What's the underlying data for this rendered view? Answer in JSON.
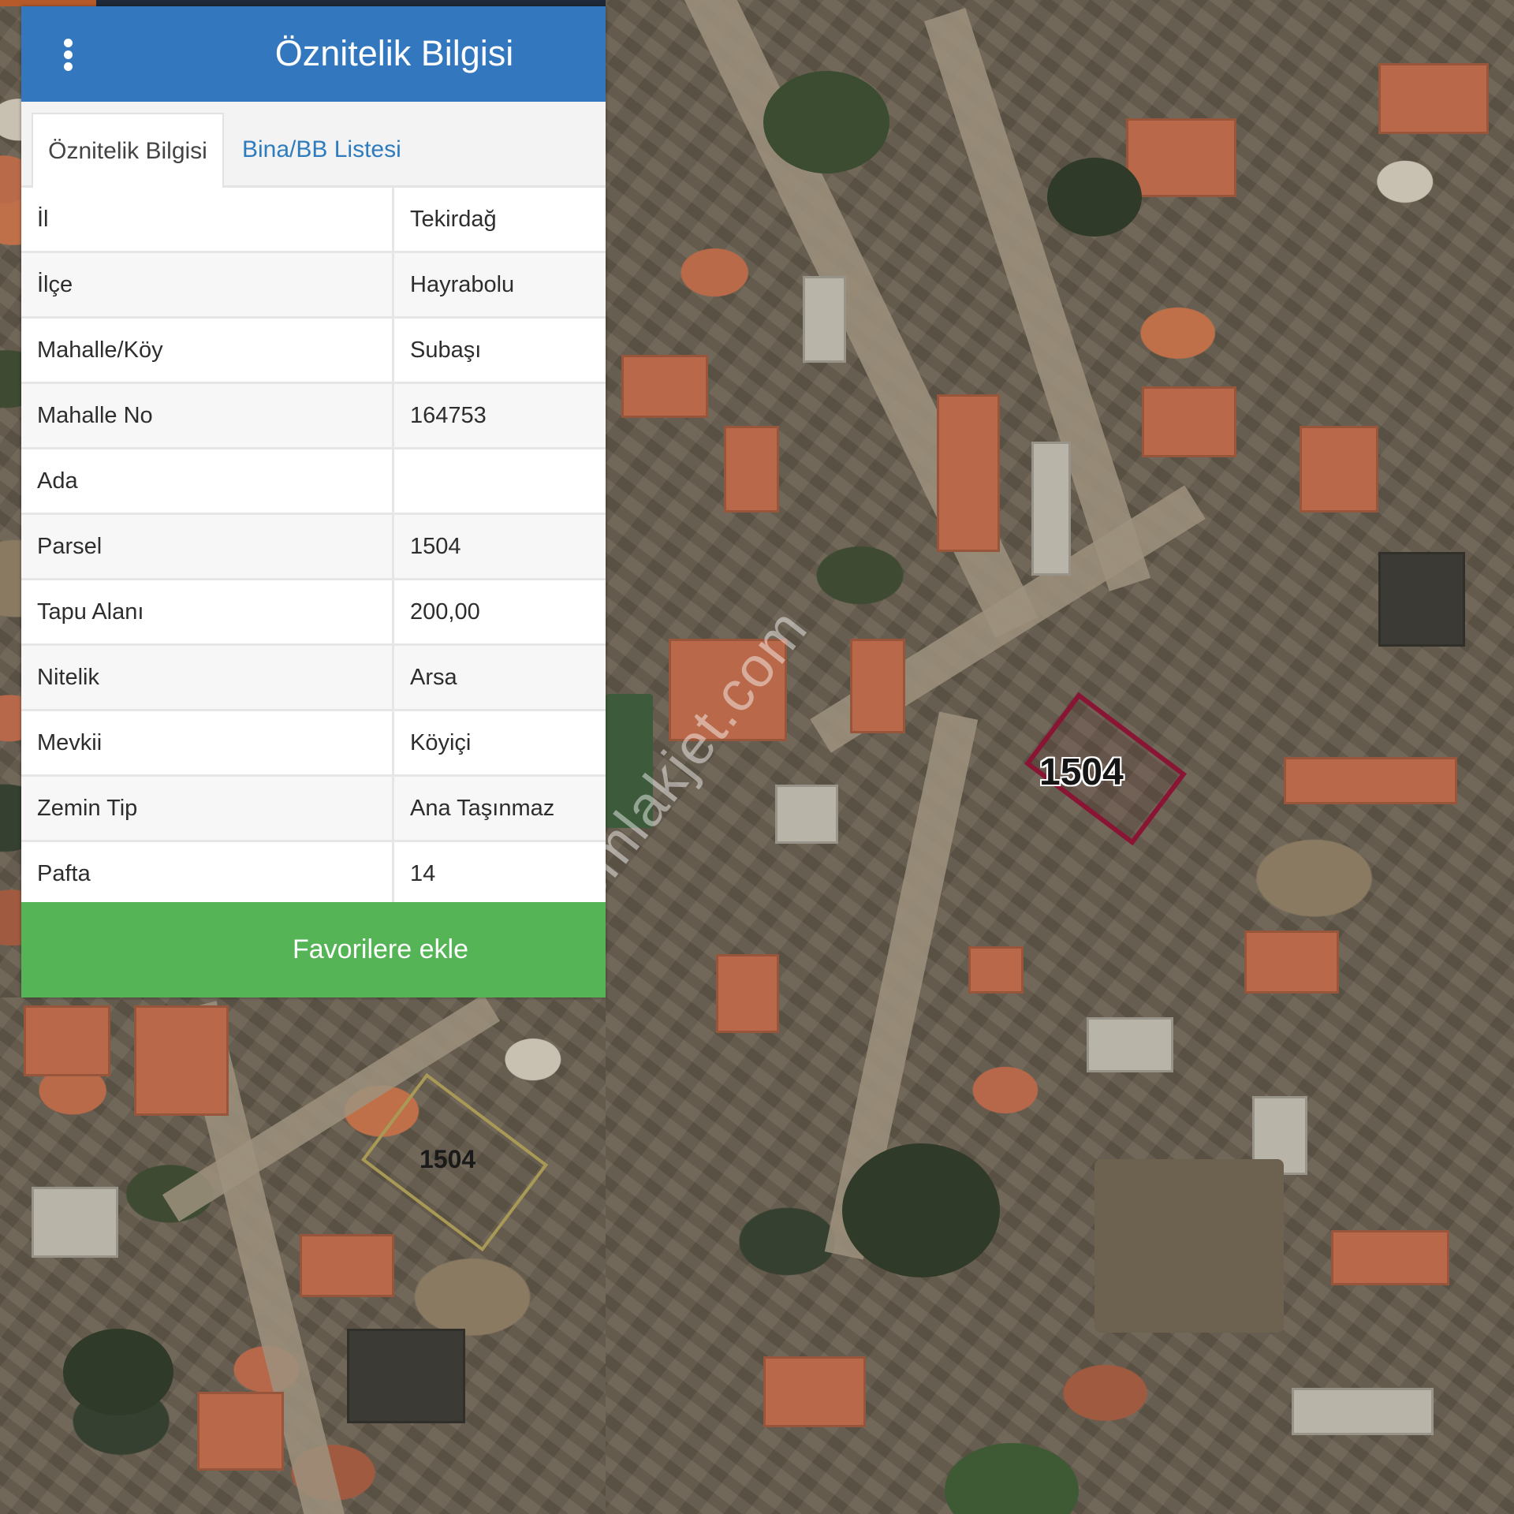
{
  "panel": {
    "title": "Öznitelik Bilgisi",
    "tabs": [
      {
        "label": "Öznitelik Bilgisi",
        "active": true
      },
      {
        "label": "Bina/BB Listesi",
        "active": false
      }
    ],
    "rows": [
      {
        "key": "İl",
        "value": "Tekirdağ"
      },
      {
        "key": "İlçe",
        "value": "Hayrabolu"
      },
      {
        "key": "Mahalle/Köy",
        "value": "Subaşı"
      },
      {
        "key": "Mahalle No",
        "value": "164753"
      },
      {
        "key": "Ada",
        "value": ""
      },
      {
        "key": "Parsel",
        "value": "1504"
      },
      {
        "key": "Tapu Alanı",
        "value": "200,00"
      },
      {
        "key": "Nitelik",
        "value": "Arsa"
      },
      {
        "key": "Mevkii",
        "value": "Köyiçi"
      },
      {
        "key": "Zemin Tip",
        "value": "Ana Taşınmaz"
      },
      {
        "key": "Pafta",
        "value": "14"
      }
    ],
    "favorite_button": "Favorilere ekle",
    "colors": {
      "header": "#3378be",
      "favorite": "#55b556",
      "tab_link": "#2e7cbd"
    }
  },
  "map": {
    "parcel_label_main": "1504",
    "parcel_label_inset": "1504",
    "parcel_outline_color": "#8a1433",
    "watermark": "emlakjet.com"
  },
  "icons": {
    "menu": "vertical-dots-menu-icon"
  }
}
